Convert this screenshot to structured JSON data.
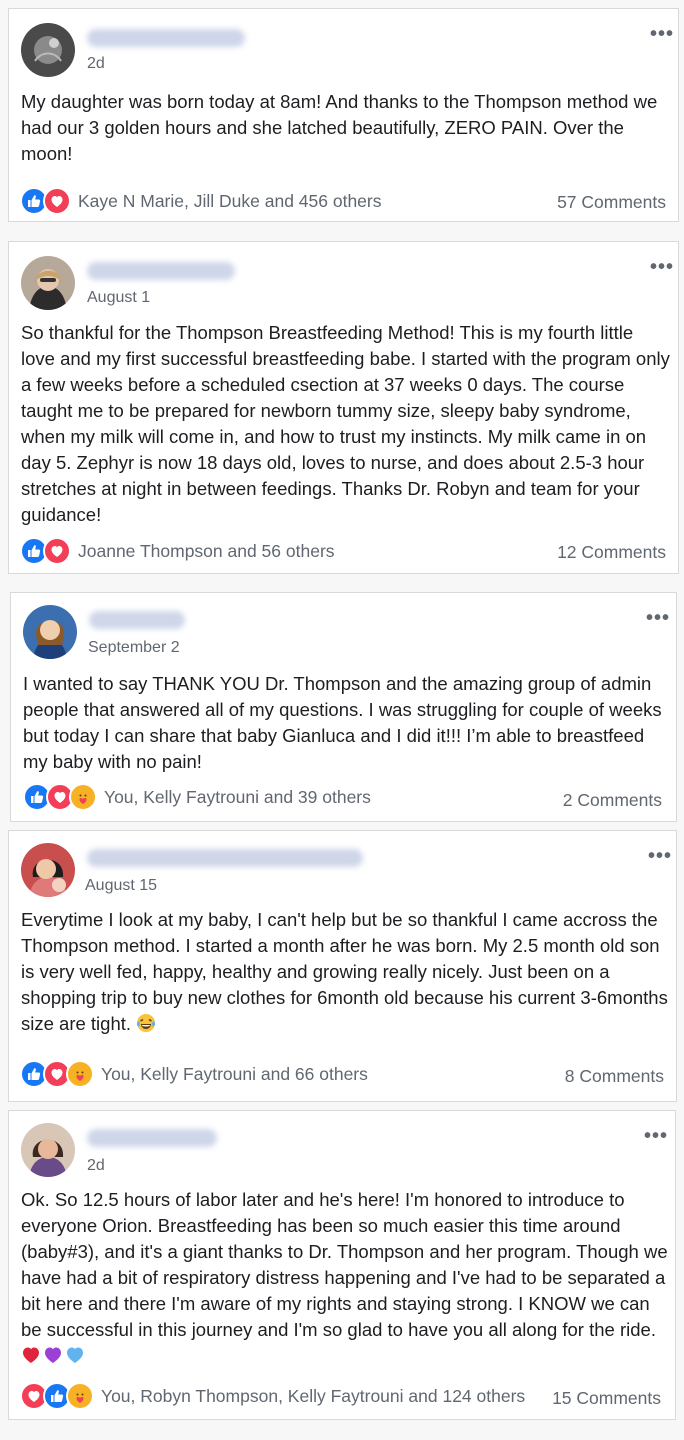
{
  "posts": [
    {
      "date": "2d",
      "body": "My daughter was born today at 8am! And thanks to the Thompson method we had our 3 golden hours and she latched beautifully, ZERO PAIN. Over the moon!",
      "reactions_text": "Kaye N Marie, Jill Duke and 456 others",
      "comments": "57 Comments",
      "reaction_icons": [
        "like-icon",
        "love-icon"
      ]
    },
    {
      "date": "August 1",
      "body": "So thankful for the Thompson Breastfeeding Method! This is my fourth little love and my first successful breastfeeding babe. I started with the program only a few weeks before a scheduled csection at 37 weeks 0 days. The course taught me to be prepared for newborn tummy size, sleepy baby syndrome, when my milk will come in, and how to trust my instincts. My milk came in on day 5. Zephyr is now 18 days old, loves to nurse, and does about 2.5-3 hour stretches at night in between feedings. Thanks Dr. Robyn and team for your guidance!",
      "reactions_text": "Joanne Thompson and 56 others",
      "comments": "12 Comments",
      "reaction_icons": [
        "like-icon",
        "love-icon"
      ]
    },
    {
      "date": "September 2",
      "body": "I wanted to say THANK YOU Dr. Thompson and the amazing group of admin people that answered all of my questions. I was struggling for couple of weeks but today I can share that baby Gianluca and I did it!!! I’m able to breastfeed my baby with no pain!",
      "reactions_text": "You, Kelly Faytrouni and 39 others",
      "comments": "2 Comments",
      "reaction_icons": [
        "like-icon",
        "love-icon",
        "care-icon"
      ]
    },
    {
      "date": "August 15",
      "body": "Everytime I look at my baby, I can't help but be so thankful I came accross the Thompson method. I started a month after he was born. My 2.5 month old son is very well fed, happy, healthy and growing really nicely. Just been on a shopping trip to buy new clothes for 6month old because his current 3-6months size are tight.",
      "body_emoji": "laughing-tears-emoji",
      "reactions_text": "You, Kelly Faytrouni and 66 others",
      "comments": "8 Comments",
      "reaction_icons": [
        "like-icon",
        "love-icon",
        "care-icon"
      ]
    },
    {
      "date": "2d",
      "body": "Ok. So 12.5 hours of labor later and he's here! I'm honored to introduce to everyone Orion. Breastfeeding has been so much easier this time around (baby#3), and it's a giant thanks to Dr. Thompson and her program. Though we have had a bit of respiratory distress happening and I've had to be separated a bit here and there I'm aware of my rights and staying strong. I KNOW we can be successful in this journey and I'm so glad to have you all along for the ride.",
      "body_hearts": [
        "red-heart-emoji",
        "purple-heart-emoji",
        "blue-heart-emoji"
      ],
      "reactions_text": "You, Robyn Thompson, Kelly Faytrouni and 124 others",
      "comments": "15 Comments",
      "reaction_icons": [
        "love-icon",
        "like-icon",
        "care-icon"
      ]
    }
  ],
  "colors": {
    "like": "#1877f2",
    "love": "#f33e58",
    "care": "#f7b125",
    "meta_text": "#606770",
    "heart_red": "#e0243b",
    "heart_purple": "#9b3fd6",
    "heart_blue": "#5fb4f0"
  }
}
